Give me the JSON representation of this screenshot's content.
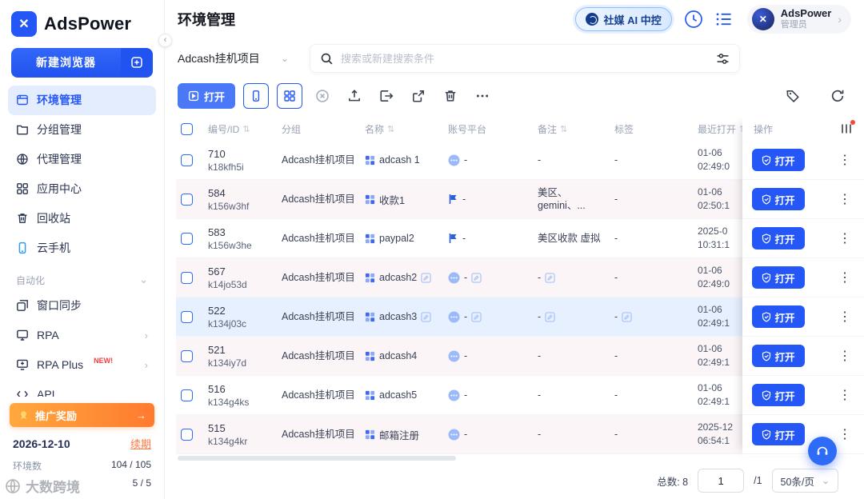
{
  "brand": {
    "name": "AdsPower"
  },
  "colors": {
    "primary": "#2457F5",
    "accent_orange": "#FF7A2F"
  },
  "sidebar": {
    "new_browser_label": "新建浏览器",
    "menu": [
      {
        "label": "环境管理"
      },
      {
        "label": "分组管理"
      },
      {
        "label": "代理管理"
      },
      {
        "label": "应用中心"
      },
      {
        "label": "回收站"
      },
      {
        "label": "云手机"
      }
    ],
    "automation_label": "自动化",
    "automation_items": [
      {
        "label": "窗口同步"
      },
      {
        "label": "RPA"
      },
      {
        "label": "RPA Plus",
        "badge": "NEW!"
      },
      {
        "label": "API"
      }
    ],
    "promo_label": "推广奖励",
    "promo_arrow": "→",
    "expiry_date": "2026-12-10",
    "renew_label": "续期",
    "env_stat": {
      "label": "环境数",
      "value": "104 / 105"
    },
    "member_stat": {
      "value": "5 / 5"
    },
    "watermark": "大数跨境"
  },
  "header": {
    "title": "环境管理",
    "ai_button_label": "社媒 AI 中控",
    "user_name": "AdsPower",
    "user_role": "管理员"
  },
  "filters": {
    "group_select_value": "Adcash挂机项目",
    "search_placeholder": "搜索或新建搜索条件"
  },
  "toolbar": {
    "open_label": "打开"
  },
  "table": {
    "columns": [
      "编号/ID",
      "分组",
      "名称",
      "账号平台",
      "备注",
      "标签",
      "最近打开",
      "操作"
    ],
    "open_label": "打开",
    "rows": [
      {
        "id": "710",
        "code": "k18kfh5i",
        "group": "Adcash挂机项目",
        "name": "adcash 1",
        "platform": "-",
        "platform_icon": "dot",
        "note": "-",
        "tag": "-",
        "date": "01-06",
        "time": "02:49:0"
      },
      {
        "id": "584",
        "code": "k156w3hf",
        "group": "Adcash挂机项目",
        "name": "收款1",
        "platform": "-",
        "platform_icon": "flag",
        "note": "美区、gemini、...",
        "tag": "-",
        "date": "01-06",
        "time": "02:50:1"
      },
      {
        "id": "583",
        "code": "k156w3he",
        "group": "Adcash挂机项目",
        "name": "paypal2",
        "platform": "-",
        "platform_icon": "flag",
        "note": "美区收款 虚拟",
        "tag": "-",
        "date": "2025-0",
        "time": "10:31:1"
      },
      {
        "id": "567",
        "code": "k14jo53d",
        "group": "Adcash挂机项目",
        "name": "adcash2",
        "platform": "-",
        "platform_icon": "dot",
        "note": "-",
        "tag": "-",
        "date": "01-06",
        "time": "02:49:0",
        "edit_name": true,
        "edit_platform": true,
        "edit_note": true
      },
      {
        "id": "522",
        "code": "k134j03c",
        "group": "Adcash挂机项目",
        "name": "adcash3",
        "platform": "-",
        "platform_icon": "dot",
        "note": "-",
        "tag": "-",
        "date": "01-06",
        "time": "02:49:1",
        "edit_name": true,
        "edit_platform": true,
        "edit_note": true,
        "edit_tag": true,
        "selected": true
      },
      {
        "id": "521",
        "code": "k134iy7d",
        "group": "Adcash挂机项目",
        "name": "adcash4",
        "platform": "-",
        "platform_icon": "dot",
        "note": "-",
        "tag": "-",
        "date": "01-06",
        "time": "02:49:1"
      },
      {
        "id": "516",
        "code": "k134g4ks",
        "group": "Adcash挂机项目",
        "name": "adcash5",
        "platform": "-",
        "platform_icon": "dot",
        "note": "-",
        "tag": "-",
        "date": "01-06",
        "time": "02:49:1"
      },
      {
        "id": "515",
        "code": "k134g4kr",
        "group": "Adcash挂机项目",
        "name": "邮箱注册",
        "platform": "-",
        "platform_icon": "dot",
        "note": "-",
        "tag": "-",
        "date": "2025-12",
        "time": "06:54:1"
      }
    ]
  },
  "pagination": {
    "total": "总数: 8",
    "page": "1",
    "page_total": "/1",
    "page_size": "50条/页"
  }
}
